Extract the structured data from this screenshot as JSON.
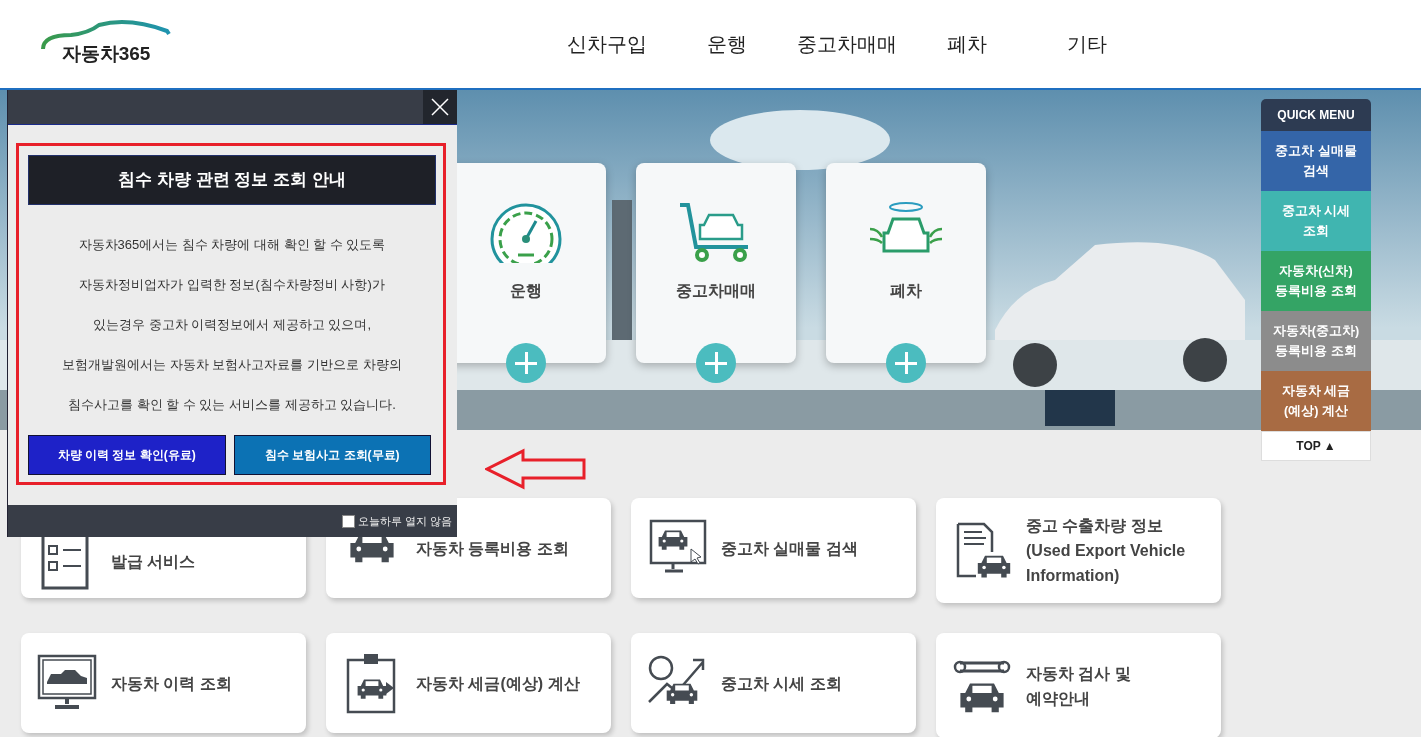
{
  "header": {
    "logo": "자동차365",
    "nav": [
      "신차구입",
      "운행",
      "중고차매매",
      "폐차",
      "기타"
    ]
  },
  "hero": {
    "cards": [
      {
        "label": "운행"
      },
      {
        "label": "중고차매매"
      },
      {
        "label": "폐차"
      }
    ]
  },
  "quick_menu": {
    "title": "QUICK MENU",
    "items": [
      {
        "label": "중고차 실매물\n검색",
        "color": "#3465a8"
      },
      {
        "label": "중고차 시세\n조회",
        "color": "#40b5b0"
      },
      {
        "label": "자동차(신차)\n등록비용 조회",
        "color": "#34a465"
      },
      {
        "label": "자동차(중고차)\n등록비용 조회",
        "color": "#8c8c8c"
      },
      {
        "label": "자동차 세금\n(예상) 계산",
        "color": "#a86b43"
      }
    ],
    "top": "TOP ▲"
  },
  "services": [
    {
      "label": "발급 서비스"
    },
    {
      "label": "자동차 등록비용 조회"
    },
    {
      "label": "중고차 실매물 검색"
    },
    {
      "label": "중고 수출차량 정보\n(Used Export Vehicle\nInformation)"
    },
    {
      "label": "자동차 이력 조회"
    },
    {
      "label": "자동차 세금(예상) 계산"
    },
    {
      "label": "중고차 시세 조회"
    },
    {
      "label": "자동차 검사 및\n예약안내"
    }
  ],
  "popup": {
    "title": "침수 차량 관련 정보 조회 안내",
    "lines": [
      "자동차365에서는 침수 차량에 대해 확인 할 수 있도록",
      "자동차정비업자가 입력한 정보(침수차량정비 사항)가",
      "있는경우 중고차 이력정보에서 제공하고 있으며,",
      "보험개발원에서는 자동차 보험사고자료를 기반으로 차량의",
      "침수사고를 확인 할 수 있는 서비스를 제공하고 있습니다."
    ],
    "buttons": [
      {
        "label": "차량 이력 정보 확인(유료)",
        "color": "#1e22c8"
      },
      {
        "label": "침수 보험사고 조회(무료)",
        "color": "#0c72b4"
      }
    ],
    "dont_show": {
      "label": "오늘하루 열지 않음",
      "checked": false
    }
  }
}
